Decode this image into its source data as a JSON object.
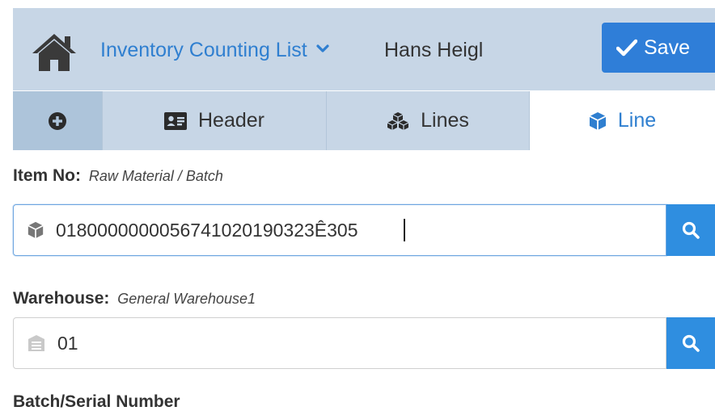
{
  "topbar": {
    "home_icon": "home-icon",
    "app_title": "Inventory Counting List",
    "user_name": "Hans Heigl",
    "save_label": "Save",
    "background": "#c7d6e6",
    "accent": "#2f7ed8"
  },
  "tabs": [
    {
      "label": "",
      "icon": "plus-circle-icon"
    },
    {
      "label": "Header",
      "icon": "id-card-icon"
    },
    {
      "label": "Lines",
      "icon": "cubes-icon"
    },
    {
      "label": "Line",
      "icon": "cube-icon",
      "active": true
    }
  ],
  "form": {
    "item": {
      "label": "Item No:",
      "sublabel": "Raw Material / Batch",
      "value": "0180000000056741020190323Ê305",
      "icon": "cube-icon"
    },
    "warehouse": {
      "label": "Warehouse:",
      "sublabel": "General Warehouse1",
      "value": "01",
      "icon": "warehouse-icon"
    },
    "batch": {
      "label": "Batch/Serial Number"
    }
  }
}
